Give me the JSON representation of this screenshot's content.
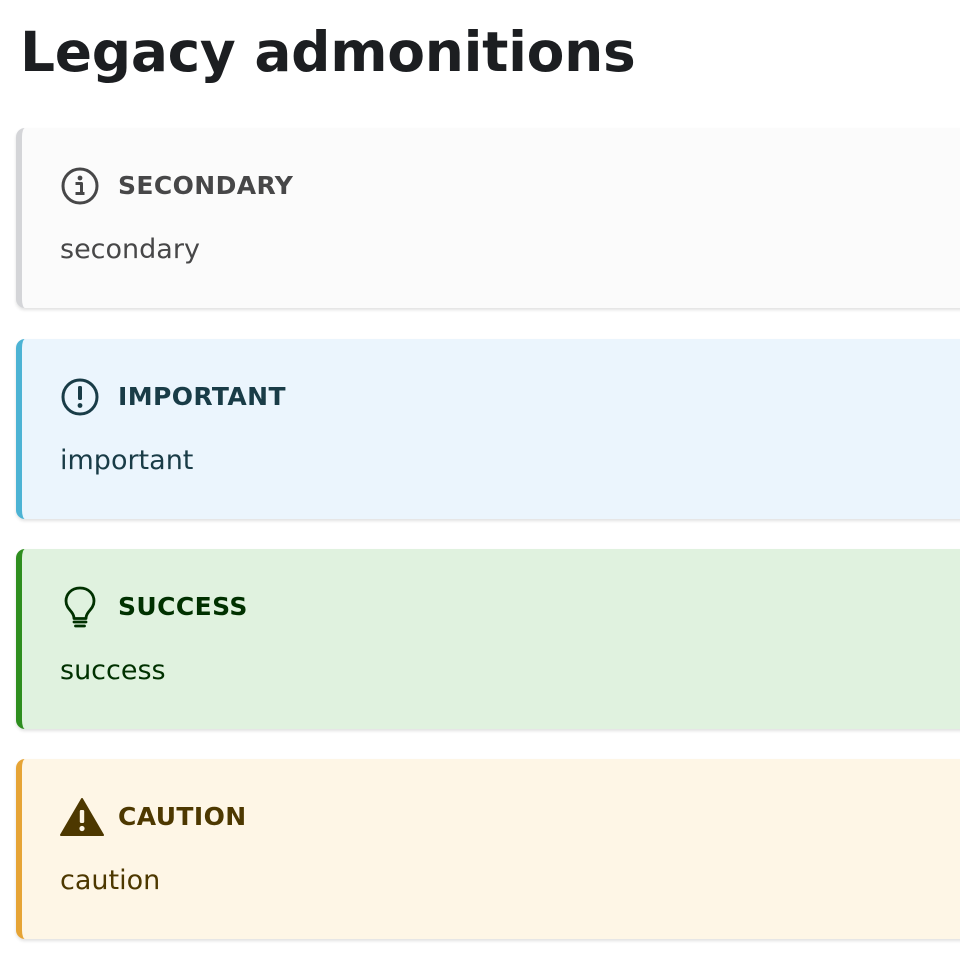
{
  "page": {
    "title": "Legacy admonitions"
  },
  "admonitions": [
    {
      "type": "secondary",
      "icon": "info-icon",
      "heading": "SECONDARY",
      "body": "secondary",
      "background_color": "#fbfbfb",
      "border_color": "#d4d5d8"
    },
    {
      "type": "important",
      "icon": "exclamation-icon",
      "heading": "IMPORTANT",
      "body": "important",
      "background_color": "#ebf5fd",
      "border_color": "#4cb3d4"
    },
    {
      "type": "success",
      "icon": "lightbulb-icon",
      "heading": "SUCCESS",
      "body": "success",
      "background_color": "#e0f2df",
      "border_color": "#2e8e1f"
    },
    {
      "type": "caution",
      "icon": "warning-icon",
      "heading": "CAUTION",
      "body": "caution",
      "background_color": "#fef6e6",
      "border_color": "#e6a435"
    }
  ]
}
